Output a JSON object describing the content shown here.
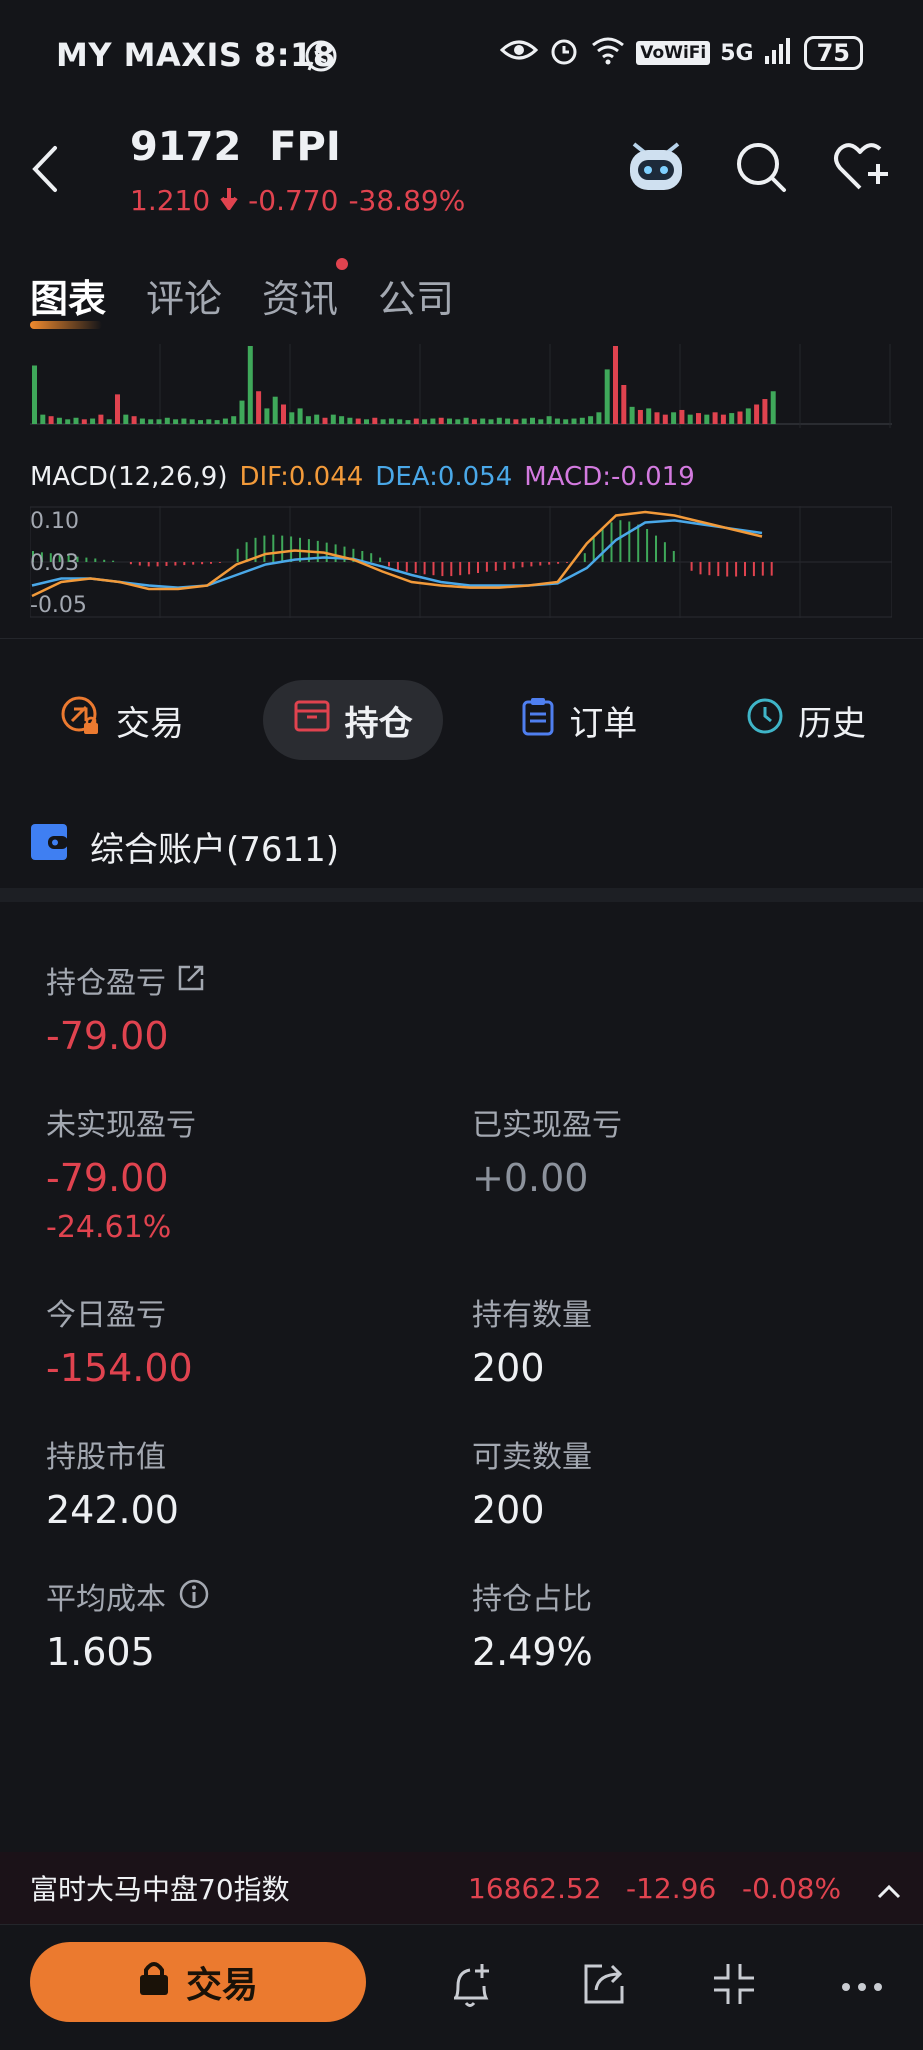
{
  "status_bar": {
    "carrier_time": "MY MAXIS 8:18",
    "network": "5G",
    "vowifi": "VoWiFi",
    "battery": "75"
  },
  "header": {
    "code": "9172",
    "name": "FPI",
    "price": "1.210",
    "change": "-0.770",
    "change_pct": "-38.89%"
  },
  "tabs": [
    {
      "label": "图表",
      "active": true
    },
    {
      "label": "评论"
    },
    {
      "label": "资讯",
      "dot": true
    },
    {
      "label": "公司"
    }
  ],
  "macd": {
    "title": "MACD(12,26,9)",
    "dif": "DIF:0.044",
    "dea": "DEA:0.054",
    "macd": "MACD:-0.019",
    "y_ticks": [
      "0.10",
      "0.03",
      "-0.05"
    ],
    "colors": {
      "dif": "#f29a3a",
      "dea": "#4aa8e8",
      "macd": "#d37adf",
      "up": "#3fa85a",
      "down": "#e0434f"
    }
  },
  "actions": [
    {
      "label": "交易",
      "icon": "trade-lock-icon"
    },
    {
      "label": "持仓",
      "icon": "position-box-icon",
      "active": true
    },
    {
      "label": "订单",
      "icon": "clipboard-icon"
    },
    {
      "label": "历史",
      "icon": "clock-icon"
    }
  ],
  "account": {
    "label": "综合账户(7611)"
  },
  "metrics": {
    "position_pl": {
      "label": "持仓盈亏",
      "value": "-79.00"
    },
    "unrealized_pl": {
      "label": "未实现盈亏",
      "value": "-79.00",
      "pct": "-24.61%"
    },
    "realized_pl": {
      "label": "已实现盈亏",
      "value": "+0.00"
    },
    "today_pl": {
      "label": "今日盈亏",
      "value": "-154.00"
    },
    "quantity": {
      "label": "持有数量",
      "value": "200"
    },
    "market_value": {
      "label": "持股市值",
      "value": "242.00"
    },
    "sellable": {
      "label": "可卖数量",
      "value": "200"
    },
    "avg_cost": {
      "label": "平均成本",
      "value": "1.605"
    },
    "position_ratio": {
      "label": "持仓占比",
      "value": "2.49%"
    }
  },
  "index_ticker": {
    "name": "富时大马中盘70指数",
    "value": "16862.52",
    "change": "-12.96",
    "change_pct": "-0.08%"
  },
  "bottom": {
    "trade_label": "交易"
  },
  "volume_bars": [
    {
      "v": 0.75,
      "c": "g"
    },
    {
      "v": 0.12,
      "c": "g"
    },
    {
      "v": 0.1,
      "c": "r"
    },
    {
      "v": 0.08,
      "c": "g"
    },
    {
      "v": 0.06,
      "c": "g"
    },
    {
      "v": 0.08,
      "c": "g"
    },
    {
      "v": 0.06,
      "c": "r"
    },
    {
      "v": 0.07,
      "c": "g"
    },
    {
      "v": 0.12,
      "c": "r"
    },
    {
      "v": 0.06,
      "c": "g"
    },
    {
      "v": 0.38,
      "c": "r"
    },
    {
      "v": 0.12,
      "c": "g"
    },
    {
      "v": 0.1,
      "c": "r"
    },
    {
      "v": 0.07,
      "c": "g"
    },
    {
      "v": 0.06,
      "c": "g"
    },
    {
      "v": 0.06,
      "c": "g"
    },
    {
      "v": 0.08,
      "c": "g"
    },
    {
      "v": 0.06,
      "c": "g"
    },
    {
      "v": 0.07,
      "c": "g"
    },
    {
      "v": 0.06,
      "c": "g"
    },
    {
      "v": 0.05,
      "c": "g"
    },
    {
      "v": 0.06,
      "c": "g"
    },
    {
      "v": 0.05,
      "c": "g"
    },
    {
      "v": 0.07,
      "c": "g"
    },
    {
      "v": 0.1,
      "c": "g"
    },
    {
      "v": 0.3,
      "c": "g"
    },
    {
      "v": 1.0,
      "c": "g"
    },
    {
      "v": 0.42,
      "c": "r"
    },
    {
      "v": 0.2,
      "c": "g"
    },
    {
      "v": 0.35,
      "c": "g"
    },
    {
      "v": 0.25,
      "c": "r"
    },
    {
      "v": 0.15,
      "c": "g"
    },
    {
      "v": 0.2,
      "c": "g"
    },
    {
      "v": 0.1,
      "c": "g"
    },
    {
      "v": 0.12,
      "c": "g"
    },
    {
      "v": 0.08,
      "c": "r"
    },
    {
      "v": 0.12,
      "c": "g"
    },
    {
      "v": 0.1,
      "c": "g"
    },
    {
      "v": 0.08,
      "c": "g"
    },
    {
      "v": 0.07,
      "c": "r"
    },
    {
      "v": 0.06,
      "c": "g"
    },
    {
      "v": 0.08,
      "c": "r"
    },
    {
      "v": 0.06,
      "c": "g"
    },
    {
      "v": 0.07,
      "c": "g"
    },
    {
      "v": 0.06,
      "c": "g"
    },
    {
      "v": 0.05,
      "c": "g"
    },
    {
      "v": 0.07,
      "c": "r"
    },
    {
      "v": 0.06,
      "c": "g"
    },
    {
      "v": 0.07,
      "c": "g"
    },
    {
      "v": 0.08,
      "c": "r"
    },
    {
      "v": 0.07,
      "c": "g"
    },
    {
      "v": 0.06,
      "c": "g"
    },
    {
      "v": 0.08,
      "c": "g"
    },
    {
      "v": 0.06,
      "c": "r"
    },
    {
      "v": 0.07,
      "c": "g"
    },
    {
      "v": 0.06,
      "c": "g"
    },
    {
      "v": 0.08,
      "c": "g"
    },
    {
      "v": 0.07,
      "c": "g"
    },
    {
      "v": 0.06,
      "c": "r"
    },
    {
      "v": 0.07,
      "c": "g"
    },
    {
      "v": 0.08,
      "c": "g"
    },
    {
      "v": 0.06,
      "c": "g"
    },
    {
      "v": 0.1,
      "c": "g"
    },
    {
      "v": 0.07,
      "c": "g"
    },
    {
      "v": 0.06,
      "c": "g"
    },
    {
      "v": 0.07,
      "c": "g"
    },
    {
      "v": 0.08,
      "c": "g"
    },
    {
      "v": 0.1,
      "c": "g"
    },
    {
      "v": 0.15,
      "c": "g"
    },
    {
      "v": 0.7,
      "c": "g"
    },
    {
      "v": 1.0,
      "c": "r"
    },
    {
      "v": 0.5,
      "c": "r"
    },
    {
      "v": 0.22,
      "c": "g"
    },
    {
      "v": 0.18,
      "c": "r"
    },
    {
      "v": 0.2,
      "c": "g"
    },
    {
      "v": 0.15,
      "c": "r"
    },
    {
      "v": 0.12,
      "c": "r"
    },
    {
      "v": 0.15,
      "c": "g"
    },
    {
      "v": 0.18,
      "c": "r"
    },
    {
      "v": 0.12,
      "c": "g"
    },
    {
      "v": 0.14,
      "c": "r"
    },
    {
      "v": 0.12,
      "c": "g"
    },
    {
      "v": 0.15,
      "c": "r"
    },
    {
      "v": 0.12,
      "c": "r"
    },
    {
      "v": 0.14,
      "c": "g"
    },
    {
      "v": 0.16,
      "c": "r"
    },
    {
      "v": 0.2,
      "c": "g"
    },
    {
      "v": 0.25,
      "c": "r"
    },
    {
      "v": 0.32,
      "c": "r"
    },
    {
      "v": 0.42,
      "c": "g"
    }
  ],
  "macd_hist": [
    0.25,
    0.22,
    0.2,
    0.18,
    0.15,
    0.12,
    0.1,
    0.08,
    0.05,
    0.03,
    0.0,
    -0.05,
    -0.08,
    -0.1,
    -0.1,
    -0.09,
    -0.08,
    -0.07,
    -0.06,
    -0.05,
    -0.04,
    -0.02,
    0.0,
    0.3,
    0.45,
    0.55,
    0.6,
    0.62,
    0.6,
    0.58,
    0.55,
    0.52,
    0.48,
    0.44,
    0.4,
    0.35,
    0.3,
    0.25,
    0.2,
    0.1,
    -0.1,
    -0.18,
    -0.22,
    -0.25,
    -0.28,
    -0.3,
    -0.32,
    -0.32,
    -0.3,
    -0.28,
    -0.25,
    -0.22,
    -0.2,
    -0.18,
    -0.15,
    -0.12,
    -0.1,
    -0.08,
    -0.06,
    -0.04,
    -0.02,
    0.0,
    0.2,
    0.55,
    0.75,
    0.9,
    0.95,
    0.92,
    0.85,
    0.75,
    0.6,
    0.45,
    0.25,
    0.0,
    -0.2,
    -0.28,
    -0.3,
    -0.32,
    -0.33,
    -0.33,
    -0.32,
    -0.32,
    -0.31,
    -0.31
  ],
  "macd_dif": [
    -0.2,
    0.0,
    0.05,
    0.0,
    -0.1,
    -0.1,
    -0.05,
    0.25,
    0.4,
    0.45,
    0.42,
    0.32,
    0.15,
    0.0,
    -0.05,
    -0.08,
    -0.08,
    -0.05,
    0.0,
    0.55,
    0.95,
    1.0,
    0.95,
    0.85,
    0.75,
    0.65
  ],
  "macd_dea": [
    -0.05,
    0.05,
    0.05,
    0.0,
    -0.05,
    -0.08,
    -0.05,
    0.1,
    0.25,
    0.32,
    0.35,
    0.33,
    0.22,
    0.1,
    0.0,
    -0.05,
    -0.05,
    -0.05,
    -0.02,
    0.2,
    0.6,
    0.85,
    0.88,
    0.82,
    0.76,
    0.7
  ]
}
